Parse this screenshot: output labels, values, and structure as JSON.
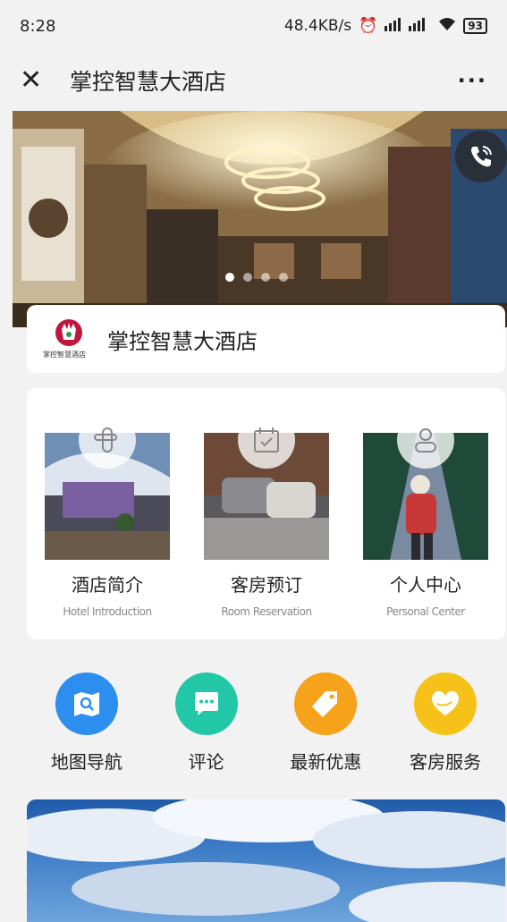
{
  "status_bar": {
    "time": "8:28",
    "network_speed": "48.4KB/s",
    "battery": "93"
  },
  "nav": {
    "title": "掌控智慧大酒店",
    "close_icon": "close-icon",
    "more_icon": "more-icon"
  },
  "banner": {
    "slide_count": 4,
    "active_slide": 1
  },
  "hotel": {
    "name": "掌控智慧大酒店",
    "logo_text": "掌控智慧酒店"
  },
  "features": [
    {
      "title": "酒店简介",
      "subtitle": "Hotel Introduction",
      "icon": "door-handle-icon"
    },
    {
      "title": "客房预订",
      "subtitle": "Room Reservation",
      "icon": "calendar-check-icon"
    },
    {
      "title": "个人中心",
      "subtitle": "Personal Center",
      "icon": "person-icon"
    }
  ],
  "quick_actions": [
    {
      "label": "地图导航",
      "icon": "map-search-icon",
      "color": "#2c8ff0"
    },
    {
      "label": "评论",
      "icon": "chat-bubble-icon",
      "color": "#22c7a8"
    },
    {
      "label": "最新优惠",
      "icon": "tag-icon",
      "color": "#f6a21a"
    },
    {
      "label": "客房服务",
      "icon": "heart-hands-icon",
      "color": "#f6c21a"
    }
  ]
}
